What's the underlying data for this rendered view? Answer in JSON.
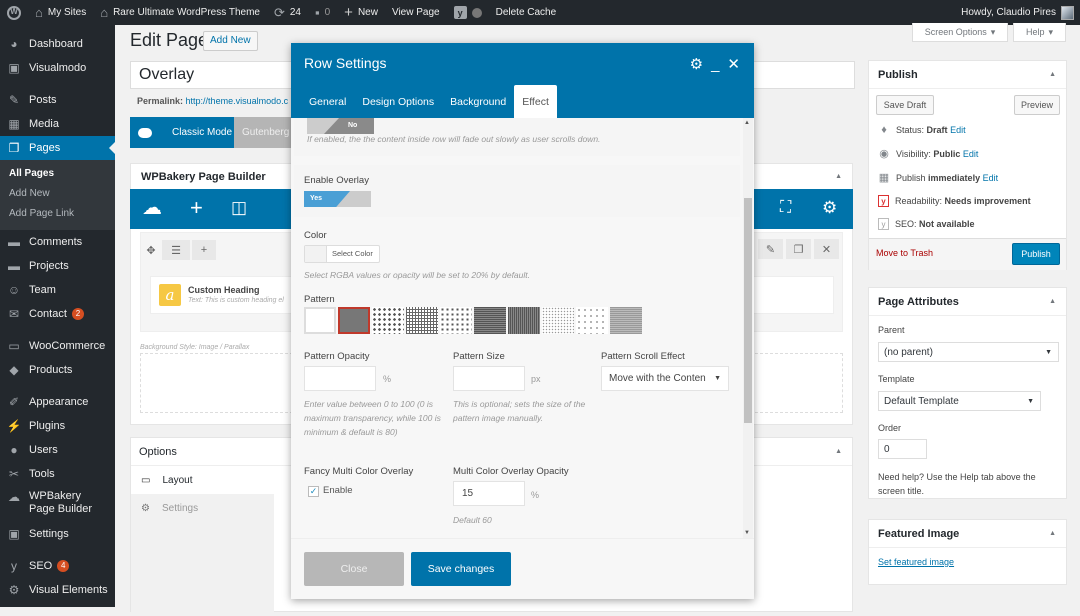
{
  "admin_bar": {
    "my_sites": "My Sites",
    "site_name": "Rare Ultimate WordPress Theme",
    "updates_count": "24",
    "comments_count": "0",
    "new_label": "New",
    "view_page": "View Page",
    "delete_cache": "Delete Cache",
    "howdy": "Howdy, Claudio Pires"
  },
  "sidebar": {
    "items": [
      {
        "label": "Dashboard",
        "icon": "dashboard-icon"
      },
      {
        "label": "Visualmodo",
        "icon": "visualmodo-icon"
      },
      {
        "label": "Posts",
        "icon": "pin-icon"
      },
      {
        "label": "Media",
        "icon": "media-icon"
      },
      {
        "label": "Pages",
        "icon": "pages-icon",
        "active": true
      },
      {
        "label": "Comments",
        "icon": "comment-icon"
      },
      {
        "label": "Projects",
        "icon": "folder-icon"
      },
      {
        "label": "Team",
        "icon": "team-icon"
      },
      {
        "label": "Contact",
        "icon": "mail-icon",
        "badge": "2"
      },
      {
        "label": "WooCommerce",
        "icon": "woo-icon"
      },
      {
        "label": "Products",
        "icon": "box-icon"
      },
      {
        "label": "Appearance",
        "icon": "brush-icon"
      },
      {
        "label": "Plugins",
        "icon": "plug-icon"
      },
      {
        "label": "Users",
        "icon": "user-icon"
      },
      {
        "label": "Tools",
        "icon": "wrench-icon"
      },
      {
        "label": "WPBakery Page Builder",
        "icon": "cloud-icon"
      },
      {
        "label": "Settings",
        "icon": "settings-icon"
      },
      {
        "label": "SEO",
        "icon": "yoast-icon",
        "badge": "4"
      },
      {
        "label": "Visual Elements",
        "icon": "gear-icon"
      }
    ],
    "submenu": [
      "All Pages",
      "Add New",
      "Add Page Link"
    ]
  },
  "editor": {
    "heading": "Edit Page",
    "add_new": "Add New",
    "title_value": "Overlay",
    "permalink_label": "Permalink:",
    "permalink_url": "http://theme.visualmodo.c",
    "classic_mode": "Classic Mode",
    "gutenberg": "Gutenberg",
    "builder_title": "WPBakery Page Builder",
    "element_title": "Custom Heading",
    "element_text": "Text: This is custom heading el",
    "bg_style": "Background Style: Image / Parallax",
    "options_title": "Options",
    "options_tabs": [
      "Layout",
      "Settings"
    ]
  },
  "right": {
    "screen_options": "Screen Options",
    "help": "Help",
    "publish": {
      "title": "Publish",
      "save_draft": "Save Draft",
      "preview": "Preview",
      "status_label": "Status:",
      "status_value": "Draft",
      "visibility_label": "Visibility:",
      "visibility_value": "Public",
      "publish_label": "Publish",
      "publish_value": "immediately",
      "edit": "Edit",
      "readability_label": "Readability:",
      "readability_value": "Needs improvement",
      "seo_label": "SEO:",
      "seo_value": "Not available",
      "trash": "Move to Trash",
      "publish_button": "Publish"
    },
    "attributes": {
      "title": "Page Attributes",
      "parent_label": "Parent",
      "parent_value": "(no parent)",
      "template_label": "Template",
      "template_value": "Default Template",
      "order_label": "Order",
      "order_value": "0",
      "help_text": "Need help? Use the Help tab above the screen title."
    },
    "featured": {
      "title": "Featured Image",
      "link": "Set featured image"
    }
  },
  "modal": {
    "title": "Row Settings",
    "tabs": [
      "General",
      "Design Options",
      "Background",
      "Effect"
    ],
    "active_tab": "Effect",
    "fade_switch_value": "No",
    "fade_help": "If enabled, the the content inside row will fade out slowly as user scrolls down.",
    "overlay_label": "Enable Overlay",
    "overlay_switch_value": "Yes",
    "color_label": "Color",
    "select_color": "Select Color",
    "color_help": "Select RGBA values or opacity will be set to 20% by default.",
    "pattern_label": "Pattern",
    "patterns": [
      "none",
      "solid",
      "dots-large",
      "grid",
      "dots-medium",
      "lines-horizontal",
      "lines-vertical",
      "dots-fine",
      "dots-sparse",
      "grid-fine"
    ],
    "selected_pattern": "solid",
    "pattern_opacity_label": "Pattern Opacity",
    "pattern_opacity_value": "",
    "pattern_opacity_unit": "%",
    "pattern_opacity_help": "Enter value between 0 to 100 (0 is maximum transparency, while 100 is minimum & default is 80)",
    "pattern_size_label": "Pattern Size",
    "pattern_size_value": "",
    "pattern_size_unit": "px",
    "pattern_size_help": "This is optional; sets the size of the pattern image manually.",
    "scroll_effect_label": "Pattern Scroll Effect",
    "scroll_effect_value": "Move with the Conten",
    "fancy_label": "Fancy Multi Color Overlay",
    "fancy_enable": "Enable",
    "fancy_checked": true,
    "multi_opacity_label": "Multi Color Overlay Opacity",
    "multi_opacity_value": "15",
    "multi_opacity_unit": "%",
    "multi_opacity_help": "Default 60",
    "close": "Close",
    "save": "Save changes"
  },
  "colors": {
    "admin_bar": "#23282d",
    "accent": "#0073aa",
    "badge": "#d54e21"
  }
}
